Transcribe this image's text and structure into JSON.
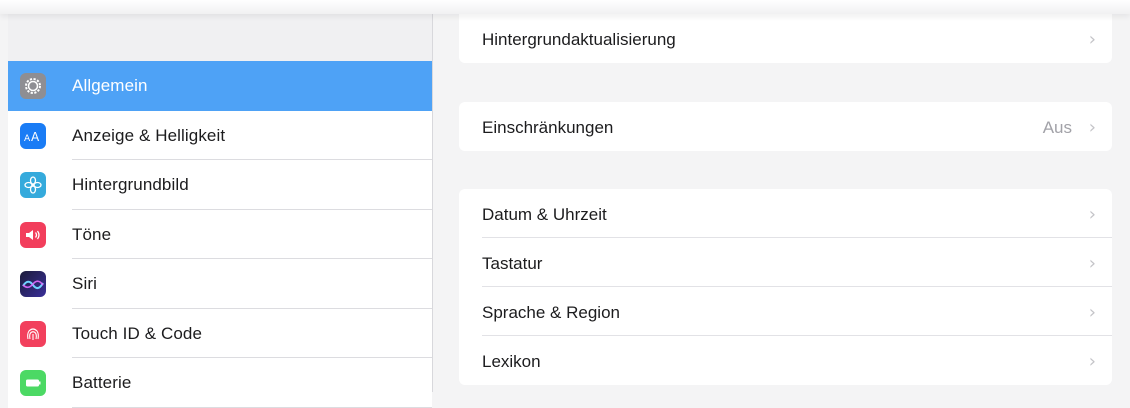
{
  "sidebar": {
    "items": [
      {
        "label": "Allgemein",
        "icon": "gear-icon",
        "color": "#8e8e93",
        "selected": true
      },
      {
        "label": "Anzeige & Helligkeit",
        "icon": "display-brightness-icon",
        "color": "#1a7cf5"
      },
      {
        "label": "Hintergrundbild",
        "icon": "wallpaper-flower-icon",
        "color": "#35aadc"
      },
      {
        "label": "Töne",
        "icon": "speaker-icon",
        "color": "#f23e5c"
      },
      {
        "label": "Siri",
        "icon": "siri-icon",
        "color": "#3c2a8c"
      },
      {
        "label": "Touch ID & Code",
        "icon": "fingerprint-icon",
        "color": "#f2405d"
      },
      {
        "label": "Batterie",
        "icon": "battery-icon",
        "color": "#4cd964"
      }
    ]
  },
  "main": {
    "group1": {
      "rows": [
        {
          "label": "Hintergrundaktualisierung"
        }
      ]
    },
    "group2": {
      "rows": [
        {
          "label": "Einschränkungen",
          "value": "Aus"
        }
      ]
    },
    "group3": {
      "rows": [
        {
          "label": "Datum & Uhrzeit"
        },
        {
          "label": "Tastatur"
        },
        {
          "label": "Sprache & Region"
        },
        {
          "label": "Lexikon"
        }
      ]
    }
  },
  "colors": {
    "accent": "#4ea2f6",
    "background": "#f4f4f5",
    "chevron": "#c4c4c8"
  }
}
